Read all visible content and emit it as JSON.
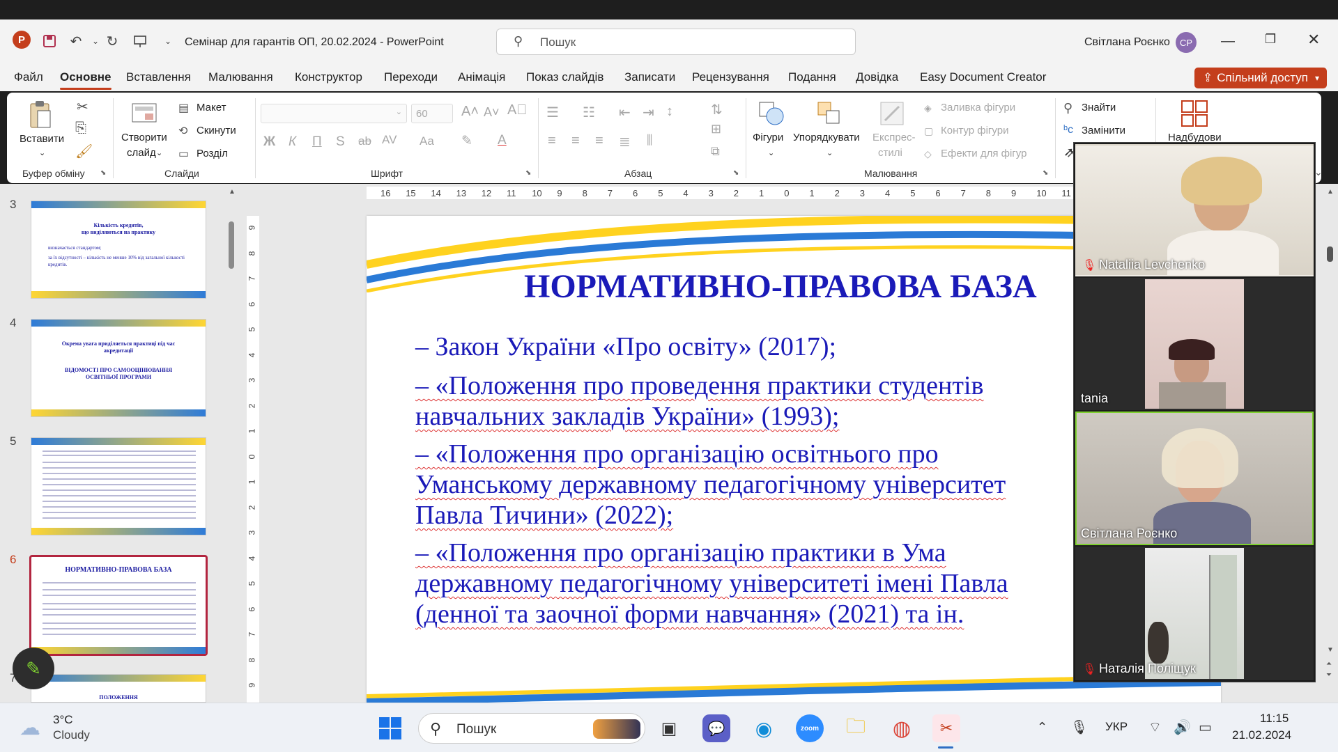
{
  "window": {
    "title": "Семінар для гарантів ОП, 20.02.2024 - PowerPoint",
    "search_placeholder": "Пошук",
    "user_name": "Світлана Роєнко",
    "user_initials": "СР"
  },
  "tabs": [
    "Файл",
    "Основне",
    "Вставлення",
    "Малювання",
    "Конструктор",
    "Переходи",
    "Анімація",
    "Показ слайдів",
    "Записати",
    "Рецензування",
    "Подання",
    "Довідка",
    "Easy Document Creator"
  ],
  "share_label": "Спільний доступ",
  "ribbon": {
    "paste": "Вставити",
    "clipboard_group": "Буфер обміну",
    "new_slide_1": "Створити",
    "new_slide_2": "слайд",
    "layout": "Макет",
    "reset": "Скинути",
    "section": "Розділ",
    "slides_group": "Слайди",
    "font_size": "60",
    "font_group": "Шрифт",
    "paragraph_group": "Абзац",
    "shapes": "Фігури",
    "arrange": "Упорядкувати",
    "quick_styles_1": "Експрес-",
    "quick_styles_2": "стилі",
    "shape_fill": "Заливка фігури",
    "shape_outline": "Контур фігури",
    "shape_effects": "Ефекти для фігур",
    "drawing_group": "Малювання",
    "find": "Знайти",
    "replace": "Замінити",
    "addins": "Надбудови"
  },
  "ruler": {
    "h_ticks": [
      "16",
      "15",
      "14",
      "13",
      "12",
      "11",
      "10",
      "9",
      "8",
      "7",
      "6",
      "5",
      "4",
      "3",
      "2",
      "1",
      "0",
      "1",
      "2",
      "3",
      "4",
      "5",
      "6",
      "7",
      "8",
      "9",
      "10",
      "11"
    ],
    "v_ticks": [
      "9",
      "8",
      "7",
      "6",
      "5",
      "4",
      "3",
      "2",
      "1",
      "0",
      "1",
      "2",
      "3",
      "4",
      "5",
      "6",
      "7",
      "8",
      "9"
    ]
  },
  "thumbnails": [
    {
      "num": "3",
      "title_1": "Кількість кредитів,",
      "title_2": "що виділяються на практику",
      "b1": "визначається стандартом;",
      "b2": "за їх відсутності – кількість не менше 10% від загальної кількості кредитів."
    },
    {
      "num": "4",
      "title_1": "Окрема увага приділяється практиці під час акредитації",
      "title_2": "ВІДОМОСТІ ПРО САМООЦІНЮВАННЯ ОСВІТНЬОЇ ПРОГРАМИ"
    },
    {
      "num": "5"
    },
    {
      "num": "6",
      "title_1": "НОРМАТИВНО-ПРАВОВА БАЗА"
    },
    {
      "num": "7",
      "title_1": "ПОЛОЖЕННЯ"
    }
  ],
  "slide": {
    "title": "НОРМАТИВНО-ПРАВОВА БАЗА",
    "b1": "–   Закон України «Про освіту» (2017);",
    "b2a": "–   «Положення про проведення практики студентів",
    "b2b": "навчальних закладів України» (1993);",
    "b3a": "–   «Положення про організацію освітнього про",
    "b3b": "Уманському державному педагогічному університет",
    "b3c": "Павла Тичини» (2022);",
    "b4a": "–   «Положення про організацію практики в Ума",
    "b4b": "державному педагогічному університеті імені Павла",
    "b4c": "(денної та заочної форми навчання» (2021) та ін."
  },
  "participants": [
    {
      "name": "Nataliia Levchenko",
      "muted": true
    },
    {
      "name": "tania",
      "muted": false
    },
    {
      "name": "Світлана Роєнко",
      "muted": false,
      "speaking": true
    },
    {
      "name": "Наталія Поліщук",
      "muted": true
    }
  ],
  "taskbar": {
    "temp": "3°C",
    "weather": "Cloudy",
    "search": "Пошук",
    "lang": "УКР",
    "time": "11:15",
    "date": "21.02.2024"
  },
  "colors": {
    "accent": "#c43e1c",
    "slide_text": "#1a1ab8",
    "speaking_border": "#7fd130"
  }
}
